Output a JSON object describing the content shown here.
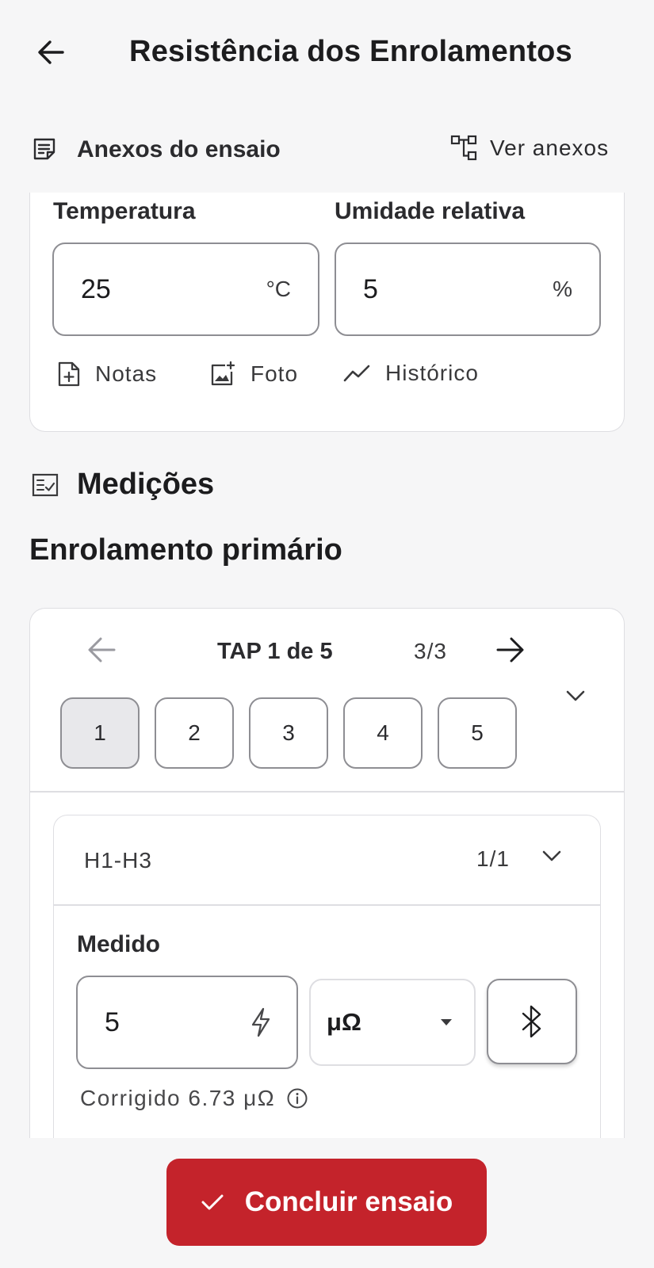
{
  "header": {
    "title": "Resistência dos Enrolamentos",
    "back_icon": "arrow-left-icon"
  },
  "attachments": {
    "label": "Anexos do ensaio",
    "view_label": "Ver anexos"
  },
  "environment": {
    "temperature": {
      "label": "Temperatura",
      "value": "25",
      "unit": "°C"
    },
    "humidity": {
      "label": "Umidade relativa",
      "value": "5",
      "unit": "%"
    },
    "actions": {
      "notes": "Notas",
      "photo": "Foto",
      "history": "Histórico"
    }
  },
  "measurements": {
    "section_title": "Medições",
    "winding_title": "Enrolamento primário",
    "tap": {
      "label": "TAP 1 de 5",
      "count": "3/3",
      "chips": [
        "1",
        "2",
        "3",
        "4",
        "5"
      ],
      "active_chip": "1"
    },
    "phase": {
      "name": "H1-H3",
      "count": "1/1",
      "measured_label": "Medido",
      "measured_value": "5",
      "unit": "μΩ",
      "corrected_text": "Corrigido 6.73 μΩ"
    }
  },
  "footer": {
    "conclude_label": "Concluir ensaio"
  },
  "colors": {
    "primary": "#c4232b",
    "background": "#f6f6f7",
    "card": "#ffffff",
    "border": "#8e8e93"
  }
}
